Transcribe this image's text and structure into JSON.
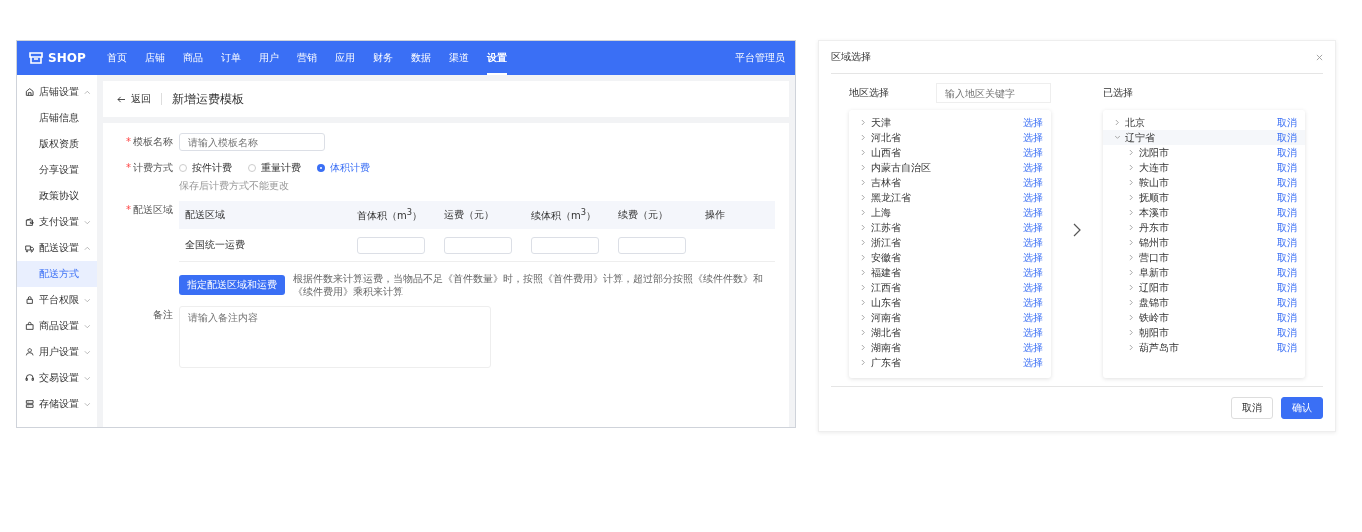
{
  "app": {
    "logo": "SHOP",
    "user": "平台管理员",
    "nav": [
      {
        "label": "首页",
        "selected": false
      },
      {
        "label": "店铺",
        "selected": false
      },
      {
        "label": "商品",
        "selected": false
      },
      {
        "label": "订单",
        "selected": false
      },
      {
        "label": "用户",
        "selected": false
      },
      {
        "label": "营销",
        "selected": false
      },
      {
        "label": "应用",
        "selected": false
      },
      {
        "label": "财务",
        "selected": false
      },
      {
        "label": "数据",
        "selected": false
      },
      {
        "label": "渠道",
        "selected": false
      },
      {
        "label": "设置",
        "selected": true
      }
    ]
  },
  "sidebar": [
    {
      "label": "店铺设置",
      "expanded": true,
      "children": [
        {
          "label": "店铺信息",
          "selected": false
        },
        {
          "label": "版权资质",
          "selected": false
        },
        {
          "label": "分享设置",
          "selected": false
        },
        {
          "label": "政策协议",
          "selected": false
        }
      ]
    },
    {
      "label": "支付设置",
      "expanded": false
    },
    {
      "label": "配送设置",
      "expanded": true,
      "children": [
        {
          "label": "配送方式",
          "selected": true
        }
      ]
    },
    {
      "label": "平台权限",
      "expanded": false
    },
    {
      "label": "商品设置",
      "expanded": false
    },
    {
      "label": "用户设置",
      "expanded": false
    },
    {
      "label": "交易设置",
      "expanded": false
    },
    {
      "label": "存储设置",
      "expanded": false
    }
  ],
  "page": {
    "back": "返回",
    "title": "新增运费模板"
  },
  "form": [
    {
      "kind": "input",
      "required_mark": "*",
      "label": "模板名称",
      "placeholder": "请输入模板名称"
    },
    {
      "kind": "radio",
      "required_mark": "*",
      "label": "计费方式",
      "options": [
        {
          "label": "按件计费",
          "selected": false
        },
        {
          "label": "重量计费",
          "selected": false
        },
        {
          "label": "体积计费",
          "selected": true
        }
      ],
      "hint": "保存后计费方式不能更改"
    },
    {
      "kind": "table",
      "required_mark": "*",
      "label": "配送区域",
      "columns": [
        "配送区域",
        "首体积（m$^{3}$）",
        "运费（元）",
        "续体积（m$^{3}$）",
        "续费（元）",
        "操作"
      ],
      "rows": [
        {
          "region": "全国统一运费"
        }
      ],
      "button": "指定配送区域和运费",
      "hint": "根据件数来计算运费，当物品不足《首件数量》时，按照《首件费用》计算，超过部分按照《续件件数》和《续件费用》乘积来计算"
    },
    {
      "kind": "textarea",
      "label": "备注",
      "placeholder": "请输入备注内容"
    }
  ],
  "dialog": {
    "title": "区域选择",
    "left": {
      "title": "地区选择",
      "search_placeholder": "输入地区关键字",
      "items": [
        {
          "label": "天津",
          "expanded": false,
          "action": "选择"
        },
        {
          "label": "河北省",
          "expanded": false,
          "action": "选择"
        },
        {
          "label": "山西省",
          "expanded": false,
          "action": "选择"
        },
        {
          "label": "内蒙古自治区",
          "expanded": false,
          "action": "选择"
        },
        {
          "label": "吉林省",
          "expanded": false,
          "action": "选择"
        },
        {
          "label": "黑龙江省",
          "expanded": false,
          "action": "选择"
        },
        {
          "label": "上海",
          "expanded": false,
          "action": "选择"
        },
        {
          "label": "江苏省",
          "expanded": false,
          "action": "选择"
        },
        {
          "label": "浙江省",
          "expanded": false,
          "action": "选择"
        },
        {
          "label": "安徽省",
          "expanded": false,
          "action": "选择"
        },
        {
          "label": "福建省",
          "expanded": false,
          "action": "选择"
        },
        {
          "label": "江西省",
          "expanded": false,
          "action": "选择"
        },
        {
          "label": "山东省",
          "expanded": false,
          "action": "选择"
        },
        {
          "label": "河南省",
          "expanded": false,
          "action": "选择"
        },
        {
          "label": "湖北省",
          "expanded": false,
          "action": "选择"
        },
        {
          "label": "湖南省",
          "expanded": false,
          "action": "选择"
        },
        {
          "label": "广东省",
          "expanded": false,
          "action": "选择"
        }
      ]
    },
    "right": {
      "title": "已选择",
      "items": [
        {
          "label": "北京",
          "expanded": false,
          "action": "取消"
        },
        {
          "label": "辽宁省",
          "expanded": true,
          "action": "取消",
          "children": [
            {
              "label": "沈阳市",
              "expanded": false,
              "action": "取消"
            },
            {
              "label": "大连市",
              "expanded": false,
              "action": "取消"
            },
            {
              "label": "鞍山市",
              "expanded": false,
              "action": "取消"
            },
            {
              "label": "抚顺市",
              "expanded": false,
              "action": "取消"
            },
            {
              "label": "本溪市",
              "expanded": false,
              "action": "取消"
            },
            {
              "label": "丹东市",
              "expanded": false,
              "action": "取消"
            },
            {
              "label": "锦州市",
              "expanded": false,
              "action": "取消"
            },
            {
              "label": "营口市",
              "expanded": false,
              "action": "取消"
            },
            {
              "label": "阜新市",
              "expanded": false,
              "action": "取消"
            },
            {
              "label": "辽阳市",
              "expanded": false,
              "action": "取消"
            },
            {
              "label": "盘锦市",
              "expanded": false,
              "action": "取消"
            },
            {
              "label": "铁岭市",
              "expanded": false,
              "action": "取消"
            },
            {
              "label": "朝阳市",
              "expanded": false,
              "action": "取消"
            },
            {
              "label": "葫芦岛市",
              "expanded": false,
              "action": "取消"
            }
          ]
        }
      ]
    },
    "buttons": [
      {
        "label": "取消",
        "kind": "default"
      },
      {
        "label": "确认",
        "kind": "primary"
      }
    ]
  }
}
